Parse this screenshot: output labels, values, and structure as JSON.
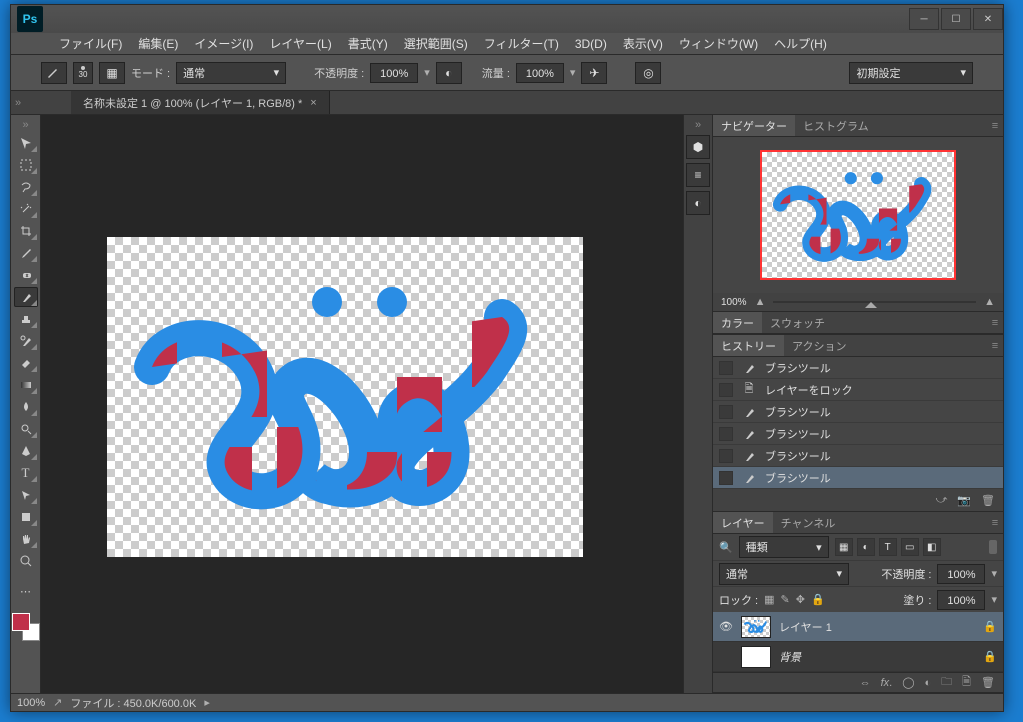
{
  "app": {
    "logo_text": "Ps"
  },
  "menubar": [
    "ファイル(F)",
    "編集(E)",
    "イメージ(I)",
    "レイヤー(L)",
    "書式(Y)",
    "選択範囲(S)",
    "フィルター(T)",
    "3D(D)",
    "表示(V)",
    "ウィンドウ(W)",
    "ヘルプ(H)"
  ],
  "optionbar": {
    "brush_size": "30",
    "mode_label": "モード :",
    "mode_value": "通常",
    "opacity_label": "不透明度 :",
    "opacity_value": "100%",
    "flow_label": "流量 :",
    "flow_value": "100%",
    "preset_label": "初期設定"
  },
  "document_tab": "名称未設定 1 @ 100% (レイヤー 1, RGB/8) *",
  "statusbar": {
    "zoom": "100%",
    "info": "ファイル : 450.0K/600.0K"
  },
  "panels": {
    "navigator": {
      "tabs": [
        "ナビゲーター",
        "ヒストグラム"
      ],
      "zoom": "100%"
    },
    "color": {
      "tabs": [
        "カラー",
        "スウォッチ"
      ]
    },
    "history": {
      "tabs": [
        "ヒストリー",
        "アクション"
      ],
      "items": [
        "ブラシツール",
        "レイヤーをロック",
        "ブラシツール",
        "ブラシツール",
        "ブラシツール",
        "ブラシツール"
      ],
      "selected_index": 5
    },
    "layer": {
      "tabs": [
        "レイヤー",
        "チャンネル"
      ],
      "filter_label": "種類",
      "blend_mode": "通常",
      "opacity_label": "不透明度 :",
      "opacity_value": "100%",
      "lock_label": "ロック :",
      "fill_label": "塗り :",
      "fill_value": "100%",
      "items": [
        {
          "name": "レイヤー 1",
          "visible": true,
          "locked": true,
          "selected": true,
          "has_art": true
        },
        {
          "name": "背景",
          "visible": false,
          "locked": true,
          "selected": false,
          "italic": true,
          "has_art": false
        }
      ]
    }
  },
  "colors": {
    "foreground": "#c0304a",
    "canvas_blue": "#2a8de4",
    "canvas_red": "#c0304a"
  }
}
